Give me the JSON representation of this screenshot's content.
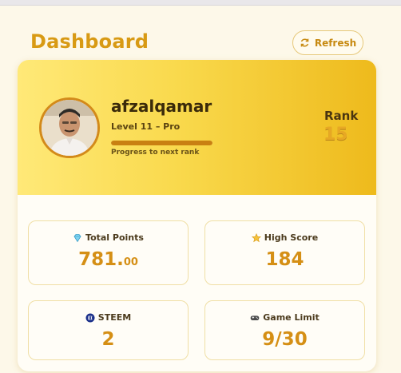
{
  "header": {
    "title": "Dashboard",
    "refresh_label": "Refresh",
    "refresh_icon": "refresh-icon"
  },
  "profile": {
    "username": "afzalqamar",
    "level": "Level 11 – Pro",
    "progress_label": "Progress to next rank",
    "progress_fraction": 1.0,
    "rank_label": "Rank",
    "rank_value": "15"
  },
  "stats": {
    "total_points": {
      "label": "Total Points",
      "value_main": "781.",
      "value_decimal": "00",
      "icon": "diamond-icon"
    },
    "high_score": {
      "label": "High Score",
      "value": "184",
      "icon": "star-icon"
    },
    "steem": {
      "label": "STEEM",
      "value": "2",
      "icon": "steem-icon"
    },
    "game_limit": {
      "label": "Game Limit",
      "value": "9/30",
      "icon": "gamepad-icon"
    }
  },
  "colors": {
    "accent": "#d89a14",
    "background": "#fdf8e9",
    "hero_start": "#ffe978",
    "hero_end": "#eeba1c"
  }
}
